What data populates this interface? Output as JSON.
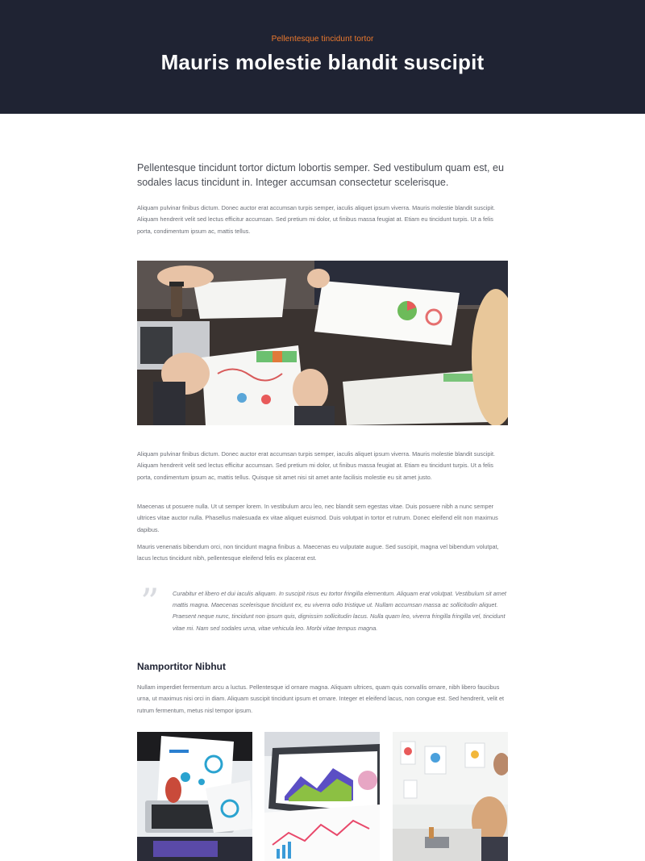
{
  "hero": {
    "eyebrow": "Pellentesque tincidunt tortor",
    "title": "Mauris molestie blandit suscipit"
  },
  "article": {
    "lead": "Pellentesque tincidunt tortor dictum lobortis semper. Sed vestibulum quam est, eu sodales lacus tincidunt in. Integer accumsan consectetur scelerisque.",
    "paragraph_1": "Aliquam pulvinar finibus dictum. Donec auctor erat accumsan turpis semper, iaculis aliquet ipsum viverra. Mauris molestie blandit suscipit. Aliquam hendrerit velit sed lectus efficitur accumsan. Sed pretium mi dolor, ut finibus massa feugiat at. Etiam eu tincidunt turpis. Ut a felis porta, condimentum ipsum ac, mattis tellus.",
    "paragraph_2": "Aliquam pulvinar finibus dictum. Donec auctor erat accumsan turpis semper, iaculis aliquet ipsum viverra. Mauris molestie blandit suscipit. Aliquam hendrerit velit sed lectus efficitur accumsan. Sed pretium mi dolor, ut finibus massa feugiat at. Etiam eu tincidunt turpis. Ut a felis porta, condimentum ipsum ac, mattis tellus. Quisque sit amet nisi sit amet ante facilisis molestie eu sit amet justo.",
    "paragraph_3": "Maecenas ut posuere nulla. Ut ut semper lorem. In vestibulum arcu leo, nec blandit sem egestas vitae. Duis posuere nibh a nunc semper ultrices vitae auctor nulla. Phasellus malesuada ex vitae aliquet euismod. Duis volutpat in tortor et rutrum. Donec eleifend elit non maximus dapibus.",
    "paragraph_4": "Mauris venenatis bibendum orci, non tincidunt magna finibus a. Maecenas eu vulputate augue. Sed suscipit, magna vel bibendum volutpat, lacus lectus tincidunt nibh, pellentesque eleifend felis ex placerat est.",
    "quote": "Curabitur et libero et dui iaculis aliquam. In suscipit risus eu tortor fringilla elementum. Aliquam erat volutpat. Vestibulum sit amet mattis magna. Maecenas scelerisque tincidunt ex, eu viverra odio tristique ut. Nullam accumsan massa ac sollicitudin aliquet. Praesent neque nunc, tincidunt non ipsum quis, dignissim sollicitudin lacus. Nulla quam leo, viverra fringilla fringilla vel, tincidunt vitae mi. Nam sed sodales urna, vitae vehicula leo. Morbi vitae tempus magna.",
    "subheading": "Namportitor Nibhut",
    "paragraph_5": "Nullam imperdiet fermentum arcu a luctus. Pellentesque id ornare magna. Aliquam ultrices, quam quis convallis ornare, nibh libero faucibus urna, ut maximus nisi orci in diam. Aliquam suscipit tincidunt ipsum et ornare. Integer et eleifend lacus, non congue est. Sed hendrerit, velit et rutrum fermentum, metus nisl tempor ipsum."
  },
  "colors": {
    "hero_bg": "#1f2333",
    "accent": "#ee7a2e",
    "heading": "#1f2333",
    "body_text": "#6b6e76"
  },
  "icons": {
    "quote": "quote-mark-icon"
  }
}
